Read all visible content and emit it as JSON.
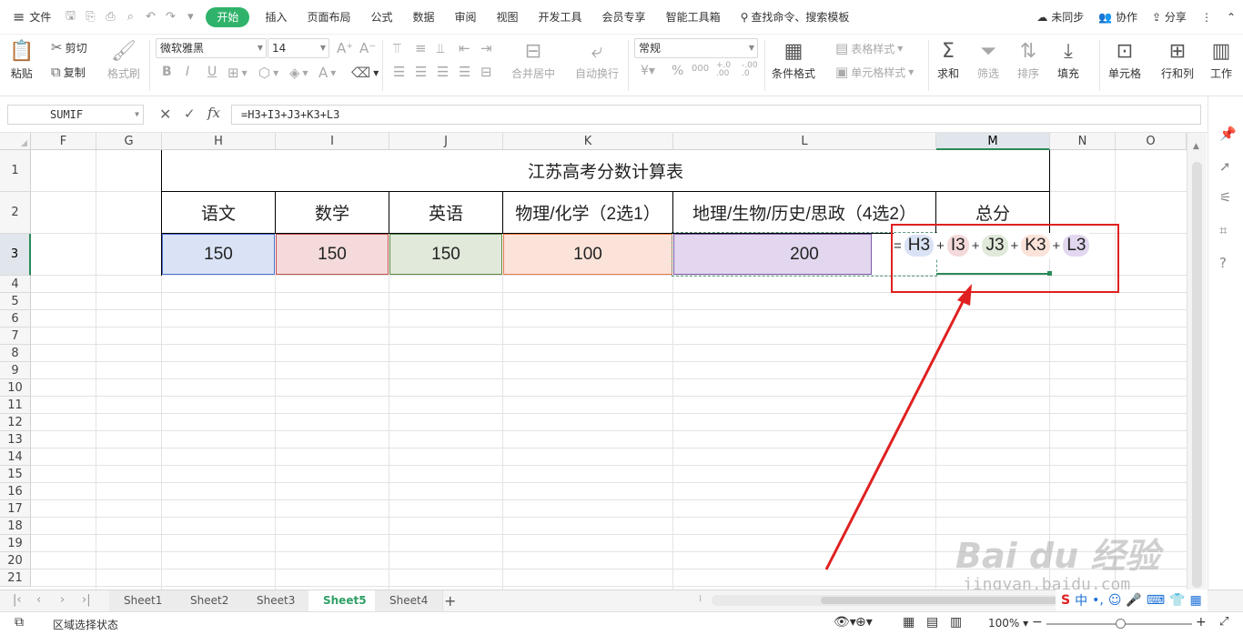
{
  "menu": {
    "file_label": "文件",
    "tabs": [
      "开始",
      "插入",
      "页面布局",
      "公式",
      "数据",
      "审阅",
      "视图",
      "开发工具",
      "会员专享",
      "智能工具箱"
    ],
    "search_placeholder": "查找命令、搜索模板",
    "right": {
      "sync": "未同步",
      "collab": "协作",
      "share": "分享"
    }
  },
  "ribbon": {
    "paste": "粘贴",
    "cut": "剪切",
    "copy": "复制",
    "format_painter": "格式刷",
    "font_name": "微软雅黑",
    "font_size": "14",
    "bold": "B",
    "italic": "I",
    "underline": "U",
    "merge_center": "合并居中",
    "wrap_text": "自动换行",
    "number_format": "常规",
    "percent": "%",
    "table_style": "表格样式",
    "cond_format": "条件格式",
    "cell_style": "单元格样式",
    "sum": "求和",
    "filter": "筛选",
    "sort": "排序",
    "fill": "填充",
    "cell": "单元格",
    "row_col": "行和列",
    "worksheet": "工作"
  },
  "formula_bar": {
    "name_box": "SUMIF",
    "formula": "=H3+I3+J3+K3+L3",
    "fx": "fx"
  },
  "columns": [
    {
      "label": "F"
    },
    {
      "label": "G"
    },
    {
      "label": "H"
    },
    {
      "label": "I"
    },
    {
      "label": "J"
    },
    {
      "label": "K"
    },
    {
      "label": "L"
    },
    {
      "label": "M"
    },
    {
      "label": "N"
    },
    {
      "label": "O"
    }
  ],
  "rows": [
    "1",
    "2",
    "3",
    "4",
    "5",
    "6",
    "7",
    "8",
    "9",
    "10",
    "11",
    "12",
    "13",
    "14",
    "15",
    "16",
    "17",
    "18",
    "19",
    "20",
    "21"
  ],
  "table": {
    "title": "江苏高考分数计算表",
    "headers": [
      "语文",
      "数学",
      "英语",
      "物理/化学（2选1）",
      "地理/生物/历史/思政（4选2）",
      "总分"
    ],
    "values": [
      "150",
      "150",
      "150",
      "100",
      "200"
    ]
  },
  "formula_edit": {
    "eq": "=",
    "refs": [
      "H3",
      "I3",
      "J3",
      "K3",
      "L3"
    ],
    "plus": "+"
  },
  "ref_colors": {
    "H": {
      "fill": "#dae3f5",
      "border": "#4a6fd0"
    },
    "I": {
      "fill": "#f4dada",
      "border": "#c0504d"
    },
    "J": {
      "fill": "#e0e9da",
      "border": "#5b8a3e"
    },
    "K": {
      "fill": "#fbe3da",
      "border": "#e87a4a"
    },
    "L": {
      "fill": "#e2d7ef",
      "border": "#7d5ba6"
    }
  },
  "annotation_color": "#e02020",
  "sheet_tabs": [
    {
      "label": "Sheet1",
      "active": false
    },
    {
      "label": "Sheet2",
      "active": false
    },
    {
      "label": "Sheet3",
      "active": false
    },
    {
      "label": "Sheet5",
      "active": true
    },
    {
      "label": "Sheet4",
      "active": false
    }
  ],
  "status": {
    "mode": "区域选择状态",
    "zoom": "100%"
  },
  "watermark": {
    "brand": "Bai du 经验",
    "url": "jingyan.baidu.com"
  }
}
